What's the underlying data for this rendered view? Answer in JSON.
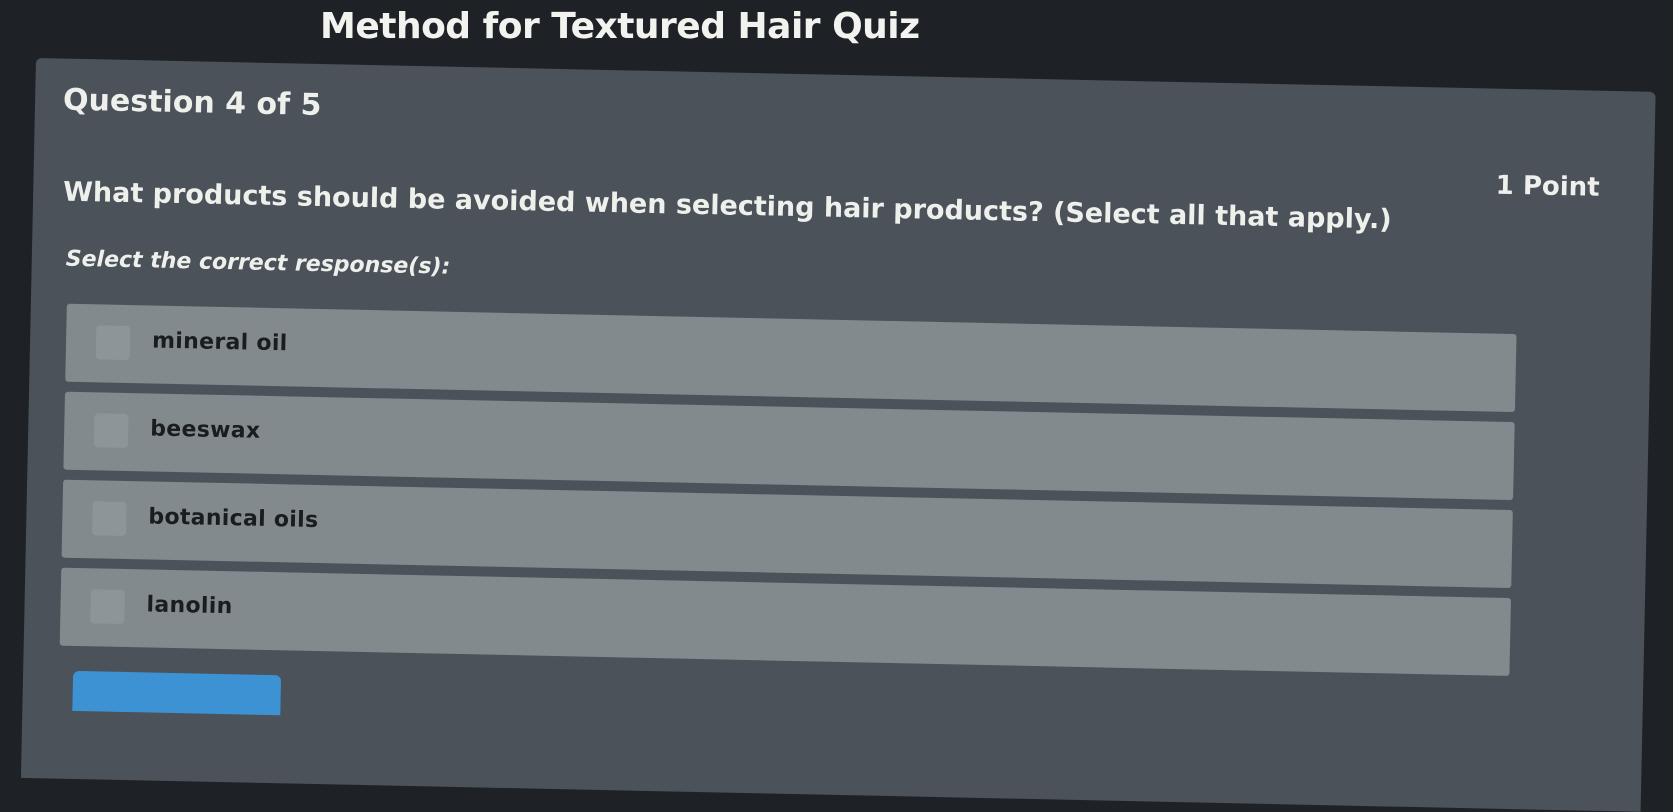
{
  "quiz": {
    "title": "Method for Textured Hair Quiz"
  },
  "question": {
    "counter": "Question 4 of 5",
    "points": "1 Point",
    "text": "What products should be avoided when selecting hair products? (Select all that apply.)",
    "instruction": "Select the correct response(s):",
    "options": [
      {
        "label": "mineral oil",
        "checked": false
      },
      {
        "label": "beeswax",
        "checked": false
      },
      {
        "label": "botanical oils",
        "checked": false
      },
      {
        "label": "lanolin",
        "checked": false
      }
    ]
  },
  "colors": {
    "background": "#1e2226",
    "card": "#4b5259",
    "option": "#838a8e",
    "accent": "#3d92d4"
  }
}
